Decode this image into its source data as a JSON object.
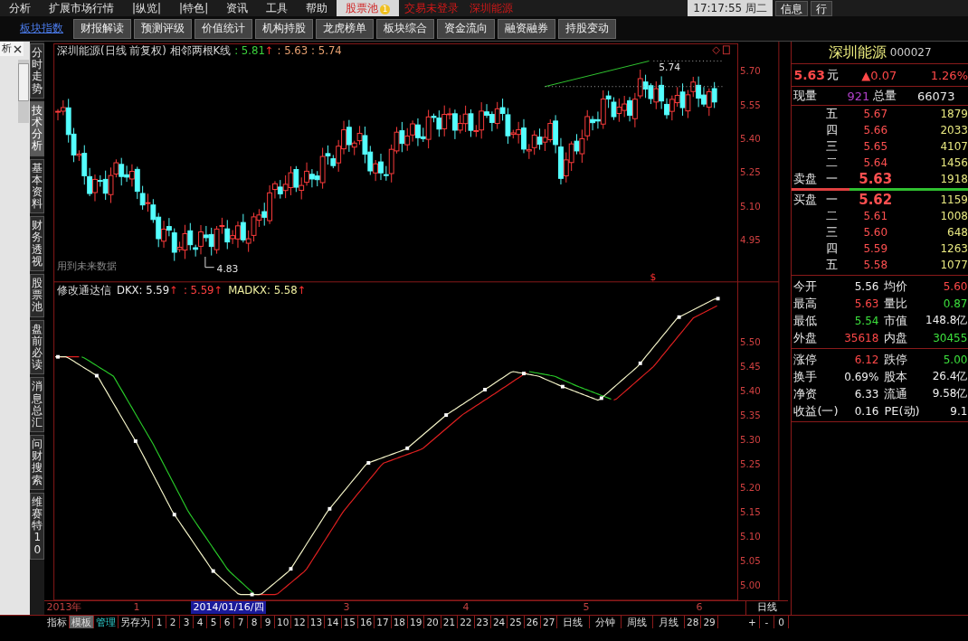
{
  "menu_bar": {
    "items": [
      {
        "label": "分析",
        "selected": false
      },
      {
        "label": "扩展市场行情",
        "selected": false
      },
      {
        "label": "|纵览|",
        "selected": false
      },
      {
        "label": "|特色|",
        "selected": false
      },
      {
        "label": "资讯",
        "selected": false
      },
      {
        "label": "工具",
        "selected": false
      },
      {
        "label": "帮助",
        "selected": false
      },
      {
        "label": "股票池",
        "badge": "1",
        "selected": true
      }
    ],
    "alerts": [
      "交易未登录",
      "深圳能源"
    ],
    "clock": "17:17:55 周二",
    "buttons": [
      "信息",
      "行"
    ]
  },
  "function_tabs": [
    {
      "label": "板块指数",
      "selected": true
    },
    {
      "label": "财报解读",
      "selected": false
    },
    {
      "label": "预测评级",
      "selected": false
    },
    {
      "label": "价值统计",
      "selected": false
    },
    {
      "label": "机构持股",
      "selected": false
    },
    {
      "label": "龙虎榜单",
      "selected": false
    },
    {
      "label": "板块综合",
      "selected": false
    },
    {
      "label": "资金流向",
      "selected": false
    },
    {
      "label": "融资融券",
      "selected": false
    },
    {
      "label": "持股变动",
      "selected": false
    }
  ],
  "left_tab": {
    "label": "析"
  },
  "side_tabs": [
    {
      "label": "分时走势",
      "selected": false
    },
    {
      "label": "技术分析",
      "selected": true
    },
    {
      "label": "基本资料",
      "selected": false
    },
    {
      "label": "财务透视",
      "selected": false
    },
    {
      "label": "股票池",
      "selected": false
    },
    {
      "label": "盘前必读",
      "selected": false
    },
    {
      "label": "消息总汇",
      "selected": false
    },
    {
      "label": "问财搜索",
      "selected": false
    },
    {
      "label": "维赛特10",
      "selected": false
    }
  ],
  "price_chart": {
    "title": "深圳能源(日线 前复权) 相邻两根K线",
    "readings": [
      {
        "text": ": 5.81",
        "arrow": "↑",
        "kind": "green"
      },
      {
        "text": ": 5.63",
        "kind": "orange"
      },
      {
        "text": ": 5.74",
        "kind": "orange"
      }
    ],
    "high_label": "5.74",
    "low_label": "4.83",
    "note": "用到未来数据",
    "marker": "$",
    "yticks": [
      "5.70",
      "5.55",
      "5.40",
      "5.25",
      "5.10",
      "4.95"
    ]
  },
  "indicator_chart": {
    "title": "修改通达信",
    "readings": [
      {
        "text": "DKX: 5.59",
        "arrow": "↑",
        "kind": "white"
      },
      {
        "text": ": 5.59",
        "arrow": "↑",
        "kind": "red"
      },
      {
        "text": "MADKX: 5.58",
        "arrow": "↑",
        "kind": "yellow"
      }
    ],
    "yticks": [
      "5.50",
      "5.45",
      "5.40",
      "5.35",
      "5.30",
      "5.25",
      "5.20",
      "5.15",
      "5.10",
      "5.05",
      "5.00"
    ]
  },
  "date_axis": {
    "labels": [
      {
        "text": "2013年",
        "kind": "plain"
      },
      {
        "text": "1",
        "kind": "plain"
      },
      {
        "text": "2014/01/16/四",
        "kind": "cursor"
      },
      {
        "text": "3",
        "kind": "plain"
      },
      {
        "text": "4",
        "kind": "plain"
      },
      {
        "text": "5",
        "kind": "plain"
      },
      {
        "text": "6",
        "kind": "plain"
      }
    ],
    "period": "日线"
  },
  "bottom_toolbar": {
    "items": [
      {
        "label": "指标",
        "kind": "tab",
        "selected": false
      },
      {
        "label": "模板",
        "kind": "tab",
        "selected": true
      },
      {
        "label": "管理",
        "kind": "link",
        "selected": false
      },
      {
        "label": "另存为",
        "kind": "tab",
        "selected": false
      },
      {
        "label": "1",
        "kind": "number",
        "selected": false
      },
      {
        "label": "2",
        "kind": "number",
        "selected": false
      },
      {
        "label": "3",
        "kind": "number",
        "selected": false
      },
      {
        "label": "4",
        "kind": "number",
        "selected": false
      },
      {
        "label": "5",
        "kind": "number",
        "selected": false
      },
      {
        "label": "6",
        "kind": "number",
        "selected": false
      },
      {
        "label": "7",
        "kind": "number",
        "selected": false
      },
      {
        "label": "8",
        "kind": "number",
        "selected": false
      },
      {
        "label": "9",
        "kind": "number",
        "selected": false
      },
      {
        "label": "10",
        "kind": "number",
        "selected": false
      },
      {
        "label": "12",
        "kind": "number",
        "selected": false
      },
      {
        "label": "13",
        "kind": "number",
        "selected": false
      },
      {
        "label": "14",
        "kind": "number",
        "selected": false
      },
      {
        "label": "15",
        "kind": "number",
        "selected": false
      },
      {
        "label": "16",
        "kind": "number",
        "selected": false
      },
      {
        "label": "17",
        "kind": "number",
        "selected": false
      },
      {
        "label": "18",
        "kind": "number",
        "selected": false
      },
      {
        "label": "19",
        "kind": "number",
        "selected": false
      },
      {
        "label": "20",
        "kind": "number",
        "selected": false
      },
      {
        "label": "21",
        "kind": "number",
        "selected": false
      },
      {
        "label": "22",
        "kind": "number",
        "selected": false
      },
      {
        "label": "23",
        "kind": "number",
        "selected": false
      },
      {
        "label": "24",
        "kind": "number",
        "selected": false
      },
      {
        "label": "25",
        "kind": "number",
        "selected": false
      },
      {
        "label": "26",
        "kind": "number",
        "selected": false
      },
      {
        "label": "27",
        "kind": "number",
        "selected": false
      },
      {
        "label": "日线",
        "kind": "period",
        "selected": false
      },
      {
        "label": "分钟",
        "kind": "period",
        "selected": false
      },
      {
        "label": "周线",
        "kind": "period",
        "selected": false
      },
      {
        "label": "月线",
        "kind": "period",
        "selected": false
      },
      {
        "label": "28",
        "kind": "number",
        "selected": false
      },
      {
        "label": "29",
        "kind": "number",
        "selected": false
      }
    ],
    "zoom_buttons": [
      "+",
      "-",
      "0"
    ]
  },
  "quote": {
    "name": "深圳能源",
    "code": "000027",
    "price": "5.63",
    "unit": "元",
    "change": "▲0.07",
    "change_pct": "1.26%",
    "volume_now_label": "现量",
    "volume_now": "921",
    "volume_total_label": "总量",
    "volume_total": "66073",
    "ask_label": "卖盘",
    "bid_label": "买盘",
    "asks": [
      {
        "level": "五",
        "price": "5.67",
        "volume": "1879",
        "best": false
      },
      {
        "level": "四",
        "price": "5.66",
        "volume": "2033",
        "best": false
      },
      {
        "level": "三",
        "price": "5.65",
        "volume": "4107",
        "best": false
      },
      {
        "level": "二",
        "price": "5.64",
        "volume": "1456",
        "best": false
      },
      {
        "level": "一",
        "price": "5.63",
        "volume": "1918",
        "best": true
      }
    ],
    "bids": [
      {
        "level": "一",
        "price": "5.62",
        "volume": "1159",
        "best": true
      },
      {
        "level": "二",
        "price": "5.61",
        "volume": "1008",
        "best": false
      },
      {
        "level": "三",
        "price": "5.60",
        "volume": "648",
        "best": false
      },
      {
        "level": "四",
        "price": "5.59",
        "volume": "1263",
        "best": false
      },
      {
        "level": "五",
        "price": "5.58",
        "volume": "1077",
        "best": false
      }
    ],
    "stats": [
      [
        {
          "label": "今开",
          "value": "5.56",
          "kind": "white"
        },
        {
          "label": "均价",
          "value": "5.60",
          "kind": "red"
        },
        {
          "label": "最高",
          "value": "5.63",
          "kind": "red"
        },
        {
          "label": "量比",
          "value": "0.87",
          "kind": "green"
        },
        {
          "label": "最低",
          "value": "5.54",
          "kind": "green"
        },
        {
          "label": "市值",
          "value": "148.8亿",
          "kind": "white"
        },
        {
          "label": "外盘",
          "value": "35618",
          "kind": "red"
        },
        {
          "label": "内盘",
          "value": "30455",
          "kind": "green"
        }
      ],
      [
        {
          "label": "涨停",
          "value": "6.12",
          "kind": "red"
        },
        {
          "label": "跌停",
          "value": "5.00",
          "kind": "green"
        },
        {
          "label": "换手",
          "value": "0.69%",
          "kind": "white"
        },
        {
          "label": "股本",
          "value": "26.4亿",
          "kind": "white"
        },
        {
          "label": "净资",
          "value": "6.33",
          "kind": "white"
        },
        {
          "label": "流通",
          "value": "9.58亿",
          "kind": "white"
        },
        {
          "label": "收益(一)",
          "value": "0.16",
          "kind": "white"
        },
        {
          "label": "PE(动)",
          "value": "9.1",
          "kind": "white"
        }
      ]
    ]
  }
}
